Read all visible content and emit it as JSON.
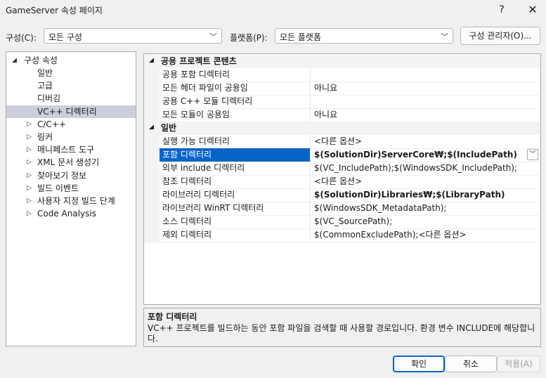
{
  "window": {
    "title": "GameServer 속성 페이지",
    "help": "?",
    "close": "✕"
  },
  "toolbar": {
    "config_label": "구성(C):",
    "config_value": "모든 구성",
    "platform_label": "플랫폼(P):",
    "platform_value": "모든 플랫폼",
    "config_manager": "구성 관리자(O)..."
  },
  "tree": {
    "root": "구성 속성",
    "items": [
      {
        "label": "일반",
        "expandable": false
      },
      {
        "label": "고급",
        "expandable": false
      },
      {
        "label": "디버깅",
        "expandable": false
      },
      {
        "label": "VC++ 디렉터리",
        "expandable": false,
        "selected": true
      },
      {
        "label": "C/C++",
        "expandable": true
      },
      {
        "label": "링커",
        "expandable": true
      },
      {
        "label": "매니페스트 도구",
        "expandable": true
      },
      {
        "label": "XML 문서 생성기",
        "expandable": true
      },
      {
        "label": "찾아보기 정보",
        "expandable": true
      },
      {
        "label": "빌드 이벤트",
        "expandable": true
      },
      {
        "label": "사용자 지정 빌드 단계",
        "expandable": true
      },
      {
        "label": "Code Analysis",
        "expandable": true
      }
    ]
  },
  "grid": {
    "categories": [
      {
        "name": "공용 프로젝트 콘텐츠",
        "rows": [
          {
            "name": "공용 포함 디렉터리",
            "value": ""
          },
          {
            "name": "모든 헤더 파일이 공용임",
            "value": "아니요"
          },
          {
            "name": "공용 C++ 모듈 디렉터리",
            "value": ""
          },
          {
            "name": "모든 모듈이 공용임",
            "value": "아니요"
          }
        ]
      },
      {
        "name": "일반",
        "rows": [
          {
            "name": "실행 가능 디렉터리",
            "value": "<다른 옵션>"
          },
          {
            "name": "포함 디렉터리",
            "value": "$(SolutionDir)ServerCore₩;$(IncludePath)",
            "selected": true,
            "bold": true
          },
          {
            "name": "외부 include 디렉터리",
            "value": "$(VC_IncludePath);$(WindowsSDK_IncludePath);"
          },
          {
            "name": "참조 디렉터리",
            "value": "<다른 옵션>"
          },
          {
            "name": "라이브러리 디렉터리",
            "value": "$(SolutionDir)Libraries₩;$(LibraryPath)",
            "bold": true
          },
          {
            "name": "라이브러리 WinRT 디렉터리",
            "value": "$(WindowsSDK_MetadataPath);"
          },
          {
            "name": "소스 디렉터리",
            "value": "$(VC_SourcePath);"
          },
          {
            "name": "제외 디렉터리",
            "value": "$(CommonExcludePath);<다른 옵션>"
          }
        ]
      }
    ]
  },
  "description": {
    "title": "포함 디렉터리",
    "text": "VC++ 프로젝트를 빌드하는 동안 포함 파일을 검색할 때 사용할 경로입니다.  환경 변수 INCLUDE에 해당합니다."
  },
  "buttons": {
    "ok": "확인",
    "cancel": "취소",
    "apply": "적용(A)"
  }
}
